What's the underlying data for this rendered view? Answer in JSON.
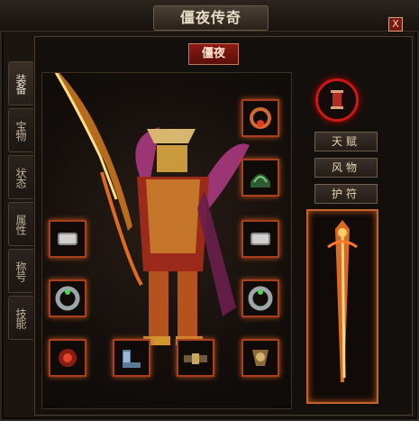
{
  "window": {
    "title": "僵夜传奇",
    "close_label": "X"
  },
  "character": {
    "name": "僵夜"
  },
  "side_tabs": [
    {
      "label": "装备",
      "active": true
    },
    {
      "label": "宝物",
      "active": false
    },
    {
      "label": "状态",
      "active": false
    },
    {
      "label": "属性",
      "active": false
    },
    {
      "label": "称号",
      "active": false
    },
    {
      "label": "技能",
      "active": false
    }
  ],
  "right_buttons": [
    {
      "label": "天赋"
    },
    {
      "label": "风物"
    },
    {
      "label": "护符"
    }
  ],
  "equipment_slots": [
    {
      "slot": "necklace-icon"
    },
    {
      "slot": "helmet-icon"
    },
    {
      "slot": "bracelet-left-icon"
    },
    {
      "slot": "bracelet-right-icon"
    },
    {
      "slot": "ring-left-icon"
    },
    {
      "slot": "ring-right-icon"
    },
    {
      "slot": "gem-icon"
    },
    {
      "slot": "boots-icon"
    },
    {
      "slot": "belt-icon"
    },
    {
      "slot": "medal-icon"
    }
  ],
  "colors": {
    "accent": "#c4642a",
    "danger": "#c51a15",
    "text_gold": "#e9d4a8"
  }
}
